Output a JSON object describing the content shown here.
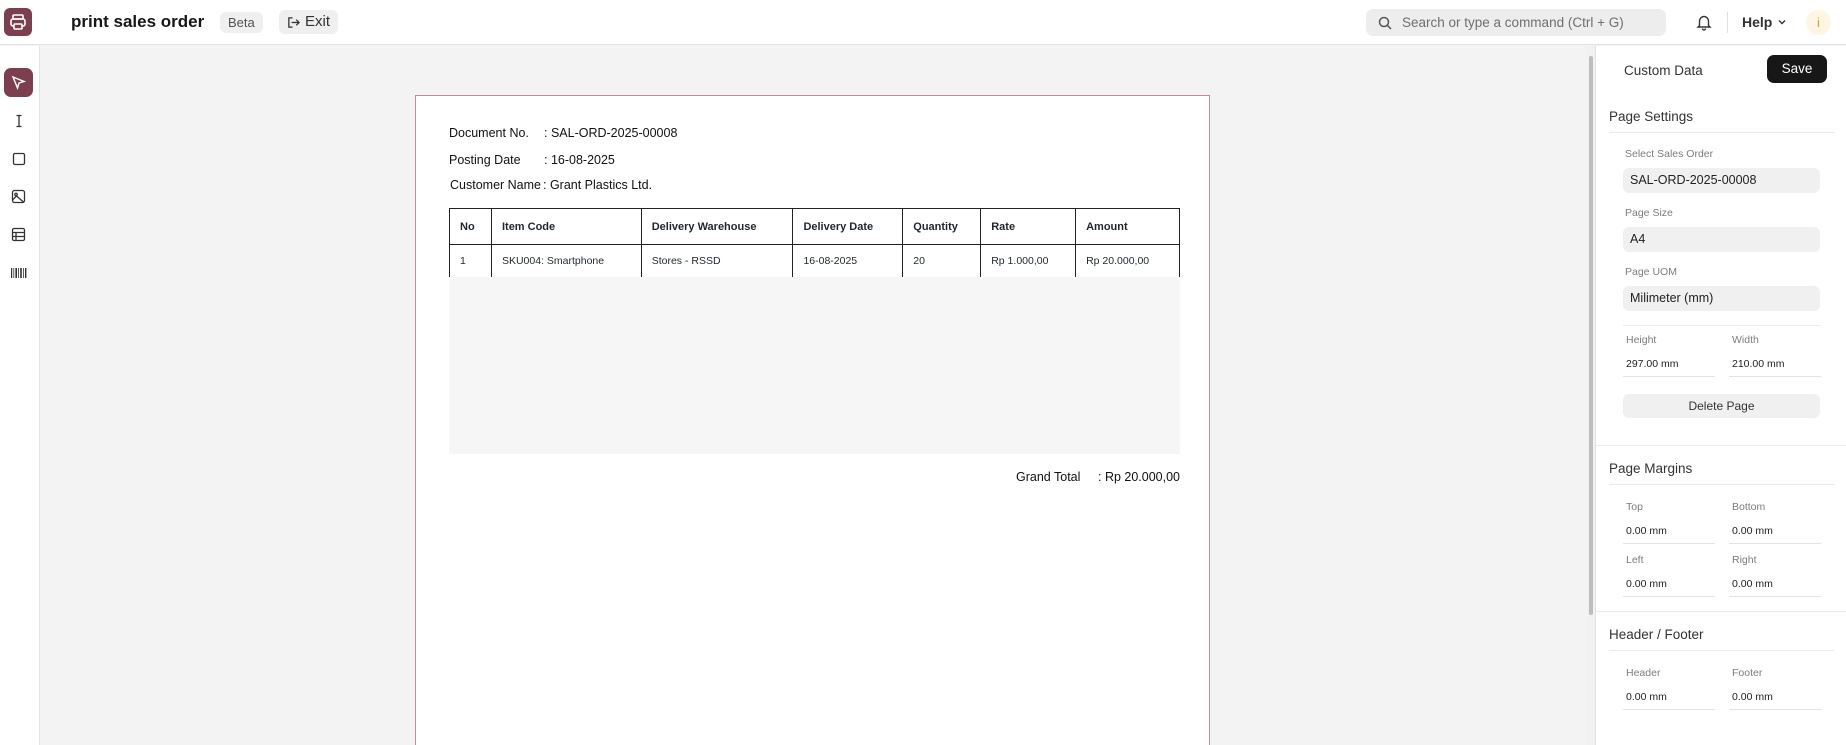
{
  "header": {
    "title": "print sales order",
    "badge": "Beta",
    "exit_label": "Exit",
    "search_placeholder": "Search or type a command (Ctrl + G)",
    "help_label": "Help",
    "avatar_initial": "i"
  },
  "tools": [
    {
      "name": "select-tool",
      "icon": "pointer-icon",
      "active": true
    },
    {
      "name": "text-tool",
      "icon": "text-cursor-icon"
    },
    {
      "name": "rectangle-tool",
      "icon": "square-icon"
    },
    {
      "name": "image-tool",
      "icon": "image-icon"
    },
    {
      "name": "table-tool",
      "icon": "table-icon"
    },
    {
      "name": "barcode-tool",
      "icon": "barcode-icon"
    }
  ],
  "document": {
    "doc_no_label": "Document No.",
    "doc_no_value": ": SAL-ORD-2025-00008",
    "posting_label": "Posting Date",
    "posting_value": ": 16-08-2025",
    "customer_label": "Customer Name",
    "customer_value": ": Grant Plastics Ltd.",
    "table": {
      "headers": [
        "No",
        "Item Code",
        "Delivery Warehouse",
        "Delivery Date",
        "Quantity",
        "Rate",
        "Amount"
      ],
      "rows": [
        [
          "1",
          "SKU004: Smartphone",
          "Stores - RSSD",
          "16-08-2025",
          "20",
          "Rp 1.000,00",
          "Rp 20.000,00"
        ]
      ]
    },
    "grand_total_label": "Grand Total",
    "grand_total_value": ": Rp 20.000,00"
  },
  "panel": {
    "custom_data_label": "Custom Data",
    "save_label": "Save",
    "page_settings": {
      "title": "Page Settings",
      "select_label": "Select Sales Order",
      "select_value": "SAL-ORD-2025-00008",
      "size_label": "Page Size",
      "size_value": "A4",
      "uom_label": "Page UOM",
      "uom_value": "Milimeter (mm)",
      "height_label": "Height",
      "height_value": "297.00 mm",
      "width_label": "Width",
      "width_value": "210.00 mm",
      "delete_label": "Delete Page"
    },
    "margins": {
      "title": "Page Margins",
      "top_label": "Top",
      "top_value": "0.00 mm",
      "bottom_label": "Bottom",
      "bottom_value": "0.00 mm",
      "left_label": "Left",
      "left_value": "0.00 mm",
      "right_label": "Right",
      "right_value": "0.00 mm"
    },
    "header_footer": {
      "title": "Header / Footer",
      "header_label": "Header",
      "header_value": "0.00 mm",
      "footer_label": "Footer",
      "footer_value": "0.00 mm"
    }
  },
  "colors": {
    "accent": "#7b3f4f",
    "save_bg": "#171717"
  }
}
